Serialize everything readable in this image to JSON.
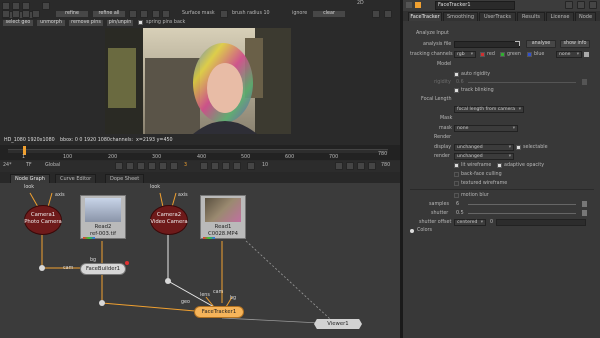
{
  "viewer_toolbar": {
    "refine": "refine",
    "refine_all": "refine all",
    "surface_mask": "Surface mask",
    "brush_radius": "brush radius 10",
    "ignore": "ignore",
    "clear": "clear",
    "select_geo": "select geo",
    "unmorph": "unmorph",
    "remove_pins": "remove pins",
    "pin_unpin": "pin/unpin",
    "spring_pins_back": "spring pins back",
    "view_mode": "2D"
  },
  "viewer_info": {
    "format": "HD_1080 1920x1080",
    "bbox": "bbox: 0 0 1920 1080",
    "channels": "channels:",
    "coords": "x=2193 y=450"
  },
  "timeline": {
    "ticks": [
      "1",
      "100",
      "200",
      "300",
      "400",
      "500",
      "600",
      "700"
    ],
    "end_frame": "780",
    "fps": "24*",
    "tf": "TF",
    "global": "Global",
    "current_frame": "3",
    "step": "10",
    "end_field": "780",
    "progress": 0.004
  },
  "graph_tabs": [
    "Node Graph",
    "Curve Editor",
    "Dope Sheet"
  ],
  "nodes": {
    "camera1": {
      "name": "Camera1",
      "sub": "Photo Camera"
    },
    "read2": {
      "name": "Read2",
      "sub": "ref-003.tif"
    },
    "camera2": {
      "name": "Camera2",
      "sub": "Video Camera"
    },
    "read1": {
      "name": "Read1",
      "sub": "C0028.MP4"
    },
    "facebuilder": {
      "name": "FaceBuilder1"
    },
    "facetracker": {
      "name": "FaceTracker1"
    },
    "viewer": {
      "name": "Viewer1"
    }
  },
  "edge_labels": {
    "look": "look",
    "axis": "axis",
    "cam": "cam",
    "geo": "geo",
    "bg": "bg",
    "look2": "look",
    "axis2": "axis",
    "cam2": "cam",
    "bg2": "bg",
    "lens": "lens"
  },
  "panel": {
    "title": "FaceTracker1",
    "tabs": [
      "FaceTracker",
      "Smoothing",
      "UserTracks",
      "Results",
      "License",
      "Node"
    ],
    "analyze_input": "Analyze Input",
    "analysis_file_label": "analysis file",
    "analyse_btn": "analyse",
    "show_info_btn": "show info",
    "tracking_channels_label": "tracking channels",
    "tracking_channels_value": "rgb",
    "red": "red",
    "green": "green",
    "blue": "blue",
    "none": "none",
    "model": "Model",
    "auto_rigidity": "auto rigidity",
    "rigidity_label": "rigidity",
    "rigidity_value": "0.6",
    "track_blinking": "track blinking",
    "focal_length": "Focal Length",
    "focal_length_value": "focal length from camera",
    "mask_heading": "Mask",
    "mask_label": "mask",
    "mask_value": "none",
    "render_heading": "Render",
    "display_label": "display",
    "display_value": "unchanged",
    "selectable": "selectable",
    "render_label": "render",
    "render_value": "unchanged",
    "lit_wireframe": "lit wireframe",
    "adaptive_opacity": "adaptive opacity",
    "back_face_culling": "back-face culling",
    "textured_wireframe": "textured wireframe",
    "motion_blur": "motion blur",
    "samples_label": "samples",
    "samples_value": "6",
    "shutter_label": "shutter",
    "shutter_value": "0.5",
    "shutter_offset_label": "shutter offset",
    "shutter_offset_value": "centered",
    "shutter_offset_num": "0",
    "colors": "Colors"
  },
  "colors": {
    "accent_orange": "#f0a030",
    "camera_node": "#6e1a1a",
    "read_node": "#bababa",
    "facetracker_node": "#f6b45a"
  }
}
